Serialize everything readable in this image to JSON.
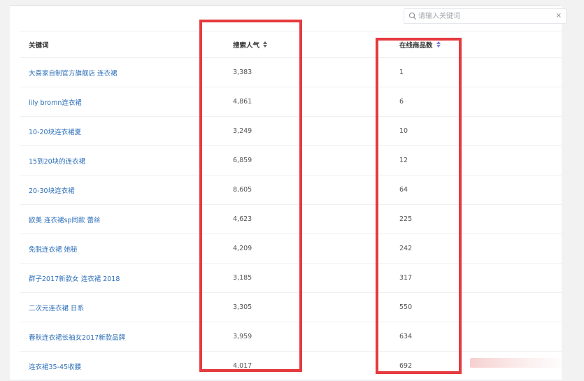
{
  "search": {
    "placeholder": "请输入关键词",
    "clear_symbol": "×"
  },
  "table": {
    "headers": {
      "keyword": "关键词",
      "search_popularity": "搜索人气",
      "online_products": "在线商品数"
    },
    "rows": [
      {
        "keyword": "大喜家自制官方旗舰店 连衣裙",
        "search_popularity": "3,383",
        "online_products": "1"
      },
      {
        "keyword": "lily bromn连衣裙",
        "search_popularity": "4,861",
        "online_products": "6"
      },
      {
        "keyword": "10-20块连衣裙夏",
        "search_popularity": "3,249",
        "online_products": "10"
      },
      {
        "keyword": "15到20块的连衣裙",
        "search_popularity": "6,859",
        "online_products": "12"
      },
      {
        "keyword": "20-30块连衣裙",
        "search_popularity": "8,605",
        "online_products": "64"
      },
      {
        "keyword": "欧美 连衣裙sp同款 蕾丝",
        "search_popularity": "4,623",
        "online_products": "225"
      },
      {
        "keyword": "免脱连衣裙 她秘",
        "search_popularity": "4,209",
        "online_products": "242"
      },
      {
        "keyword": "群子2017新款女 连衣裙 2018",
        "search_popularity": "3,185",
        "online_products": "317"
      },
      {
        "keyword": "二次元连衣裙 日系",
        "search_popularity": "3,305",
        "online_products": "550"
      },
      {
        "keyword": "春秋连衣裙长袖女2017新款品牌",
        "search_popularity": "3,959",
        "online_products": "634"
      },
      {
        "keyword": "连衣裙35-45收腰",
        "search_popularity": "4,017",
        "online_products": "692"
      }
    ]
  },
  "colors": {
    "highlight": "#e53a3e",
    "link": "#2b6eb8",
    "active_sort": "#7b7dd8"
  },
  "icons": {
    "search": "search-icon",
    "sort": "sort-icon",
    "clear": "close-icon"
  }
}
